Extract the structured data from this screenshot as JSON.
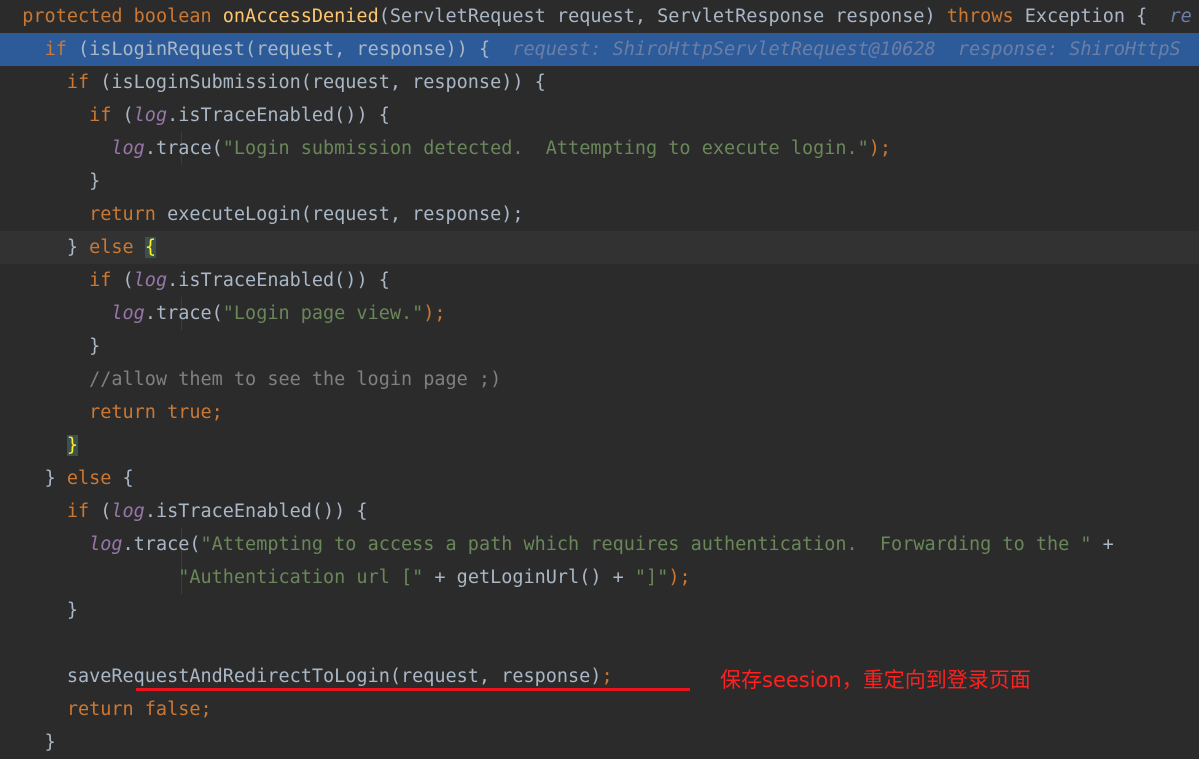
{
  "code": {
    "l1": {
      "protected": "protected",
      "boolean": "boolean",
      "method": "onAccessDenied",
      "params": "(ServletRequest request, ServletResponse response) ",
      "throws": "throws",
      "rest": " Exception {  ",
      "hint": "re"
    },
    "l2": {
      "if": "if",
      "cond": " (isLoginRequest(request, response)) {  ",
      "hint": "request: ShiroHttpServletRequest@10628  response: ShiroHttpS"
    },
    "l3": {
      "if": "if",
      "cond": " (isLoginSubmission(request, response)) {"
    },
    "l4": {
      "if": "if",
      "open": " (",
      "log": "log",
      "rest": ".isTraceEnabled()) {"
    },
    "l5": {
      "log": "log",
      "call": ".trace(",
      "str": "\"Login submission detected.  Attempting to execute login.\"",
      "end": ");"
    },
    "l6": {
      "text": "}"
    },
    "l7": {
      "return": "return",
      "rest": " executeLogin(request, response);"
    },
    "l8": {
      "close": "} ",
      "else": "else",
      "brace": "{"
    },
    "l9": {
      "if": "if",
      "open": " (",
      "log": "log",
      "rest": ".isTraceEnabled()) {"
    },
    "l10": {
      "log": "log",
      "call": ".trace(",
      "str": "\"Login page view.\"",
      "end": ");"
    },
    "l11": {
      "text": "}"
    },
    "l12": {
      "comment": "//allow them to see the login page ;)"
    },
    "l13": {
      "return": "return",
      "value": " true",
      "end": ";"
    },
    "l14": {
      "brace": "}"
    },
    "l15": {
      "close": "} ",
      "else": "else",
      "rest": " {"
    },
    "l16": {
      "if": "if",
      "open": " (",
      "log": "log",
      "rest": ".isTraceEnabled()) {"
    },
    "l17": {
      "log": "log",
      "call": ".trace(",
      "str": "\"Attempting to access a path which requires authentication.  Forwarding to the \"",
      "end": " +"
    },
    "l18": {
      "str1": "\"Authentication url [\"",
      "mid": " + getLoginUrl() + ",
      "str2": "\"]\"",
      "end": ");"
    },
    "l19": {
      "text": "}"
    },
    "l21": {
      "call": "saveRequestAndRedirectToLogin(request, response)",
      "end": ";"
    },
    "l22": {
      "return": "return",
      "value": " false",
      "end": ";"
    },
    "l23": {
      "text": "}"
    }
  },
  "annotation": {
    "text": "保存seesion，重定向到登录页面",
    "color": "#ff2020"
  },
  "colors": {
    "background": "#2b2b2b",
    "keyword": "#cc7832",
    "method": "#ffc66d",
    "string": "#6a8759",
    "field": "#9876aa",
    "selection": "#2d5b9a"
  }
}
